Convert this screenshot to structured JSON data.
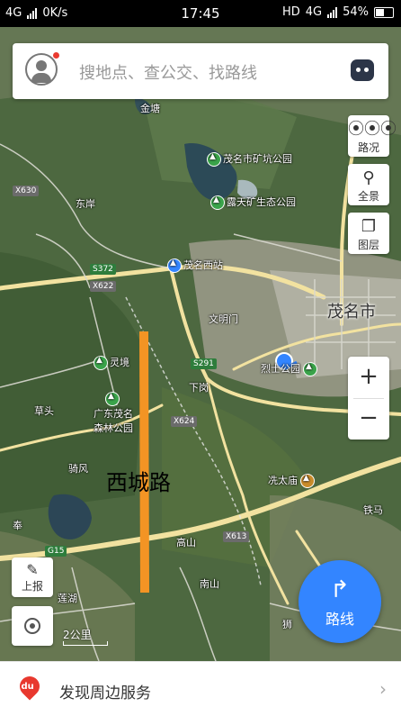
{
  "status_bar": {
    "network": "4G",
    "speed": "0K/s",
    "time": "17:45",
    "hd": "HD",
    "network_right": "4G",
    "battery": "54%"
  },
  "search": {
    "placeholder": "搜地点、查公交、找路线"
  },
  "controls": {
    "traffic": "路况",
    "panorama": "全景",
    "layers": "图层",
    "zoom_in": "+",
    "zoom_out": "−",
    "report": "上报",
    "scale": "2公里",
    "route": "路线"
  },
  "map_labels": {
    "road_highlight": "西城路",
    "city": "茂名市",
    "mine_park": "茂名市矿坑公园",
    "eco_park": "露天矿生态公园",
    "station": "茂名西站",
    "martyrs_park": "烈士公园",
    "lingjing": "灵境",
    "guangdong": "广东茂名",
    "fauna": "森林公园",
    "temple": "冼太庙",
    "xiagang": "下岗",
    "caolu": "草头",
    "wenming": "文明门",
    "gaoshan": "高山",
    "yanghu": "莲湖",
    "dongguan": "东岸",
    "tiema": "铁马",
    "nanshan": "南山",
    "jinlun": "金塘",
    "qifeng": "骑风",
    "feng": "奉",
    "shi": "狮"
  },
  "route_shields": {
    "x630": "X630",
    "s372": "S372",
    "x622": "X622",
    "s291": "S291",
    "x624": "X624",
    "x613": "X613",
    "g15": "G15"
  },
  "bottom_bar": {
    "logo": "du",
    "text": "发现周边服务",
    "chevron": "›"
  },
  "colors": {
    "route_button": "#3385ff",
    "highlight_road": "#f39424",
    "location_dot": "#3385ff"
  }
}
